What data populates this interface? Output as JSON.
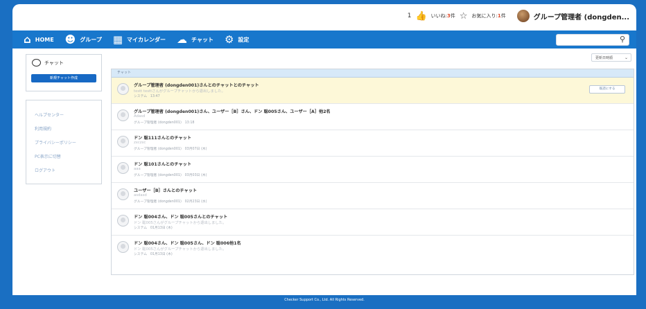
{
  "topbar": {
    "bell_count": "1",
    "likes_label": "いいね:",
    "likes_count": "3",
    "likes_unit": "件",
    "favorites_label": "お気に入り:",
    "favorites_count": "1",
    "favorites_unit": "件",
    "user_name": "グループ管理者 (dongden..."
  },
  "nav": {
    "items": [
      {
        "label": "HOME",
        "icon": "home-icon"
      },
      {
        "label": "グループ",
        "icon": "group-icon"
      },
      {
        "label": "マイカレンダー",
        "icon": "calendar-icon"
      },
      {
        "label": "チャット",
        "icon": "chat-icon"
      },
      {
        "label": "設定",
        "icon": "settings-gear-icon"
      }
    ],
    "search_placeholder": ""
  },
  "sidebar": {
    "chat_title": "チャット",
    "new_chat_label": "新規チャット作成",
    "links": [
      "ヘルプセンター",
      "利用規約",
      "プライバシーポリシー",
      "PC表示に切替",
      "ログアウト"
    ]
  },
  "main": {
    "sort_label": "更新日時順",
    "panel_title": "チャット",
    "rows": [
      {
        "title": "グループ管理者 (dongden001)さんとのチャットとのチャット",
        "preview": "testt testtさんがグループチャットから退出しました。",
        "meta": "システム　13:47",
        "button": "既読にする"
      },
      {
        "title": "グループ管理者 (dongden001)さん、ユーザー［B］さん、ドン 聡005さん、ユーザー［A］他2名",
        "preview": "Adasd",
        "meta": "グループ管理者 (dongden001)　13:18",
        "button": ""
      },
      {
        "title": "ドン 聡111さんとのチャット",
        "preview": "zxczxc",
        "meta": "グループ管理者 (dongden001)　03月07日 (木)",
        "button": ""
      },
      {
        "title": "ドン 聡101さんとのチャット",
        "preview": "aaa",
        "meta": "グループ管理者 (dongden001)　03月03日 (木)",
        "button": ""
      },
      {
        "title": "ユーザー［B］さんとのチャット",
        "preview": "asdasd",
        "meta": "グループ管理者 (dongden001)　02月23日 (水)",
        "button": ""
      },
      {
        "title": "ドン 聡004さん、ドン 聡005さんとのチャット",
        "preview": "ドン 聡005さんがグループチャットから退出しました。",
        "meta": "システム　01月13日 (木)",
        "button": ""
      },
      {
        "title": "ドン 聡004さん、ドン 聡005さん、ドン 聡006他1名",
        "preview": "ドン 聡005さんがグループチャットから退出しました。",
        "meta": "システム　01月13日 (木)",
        "button": ""
      }
    ]
  },
  "footer": {
    "text": "Checker Support Co., Ltd. All Rights Reserved."
  }
}
